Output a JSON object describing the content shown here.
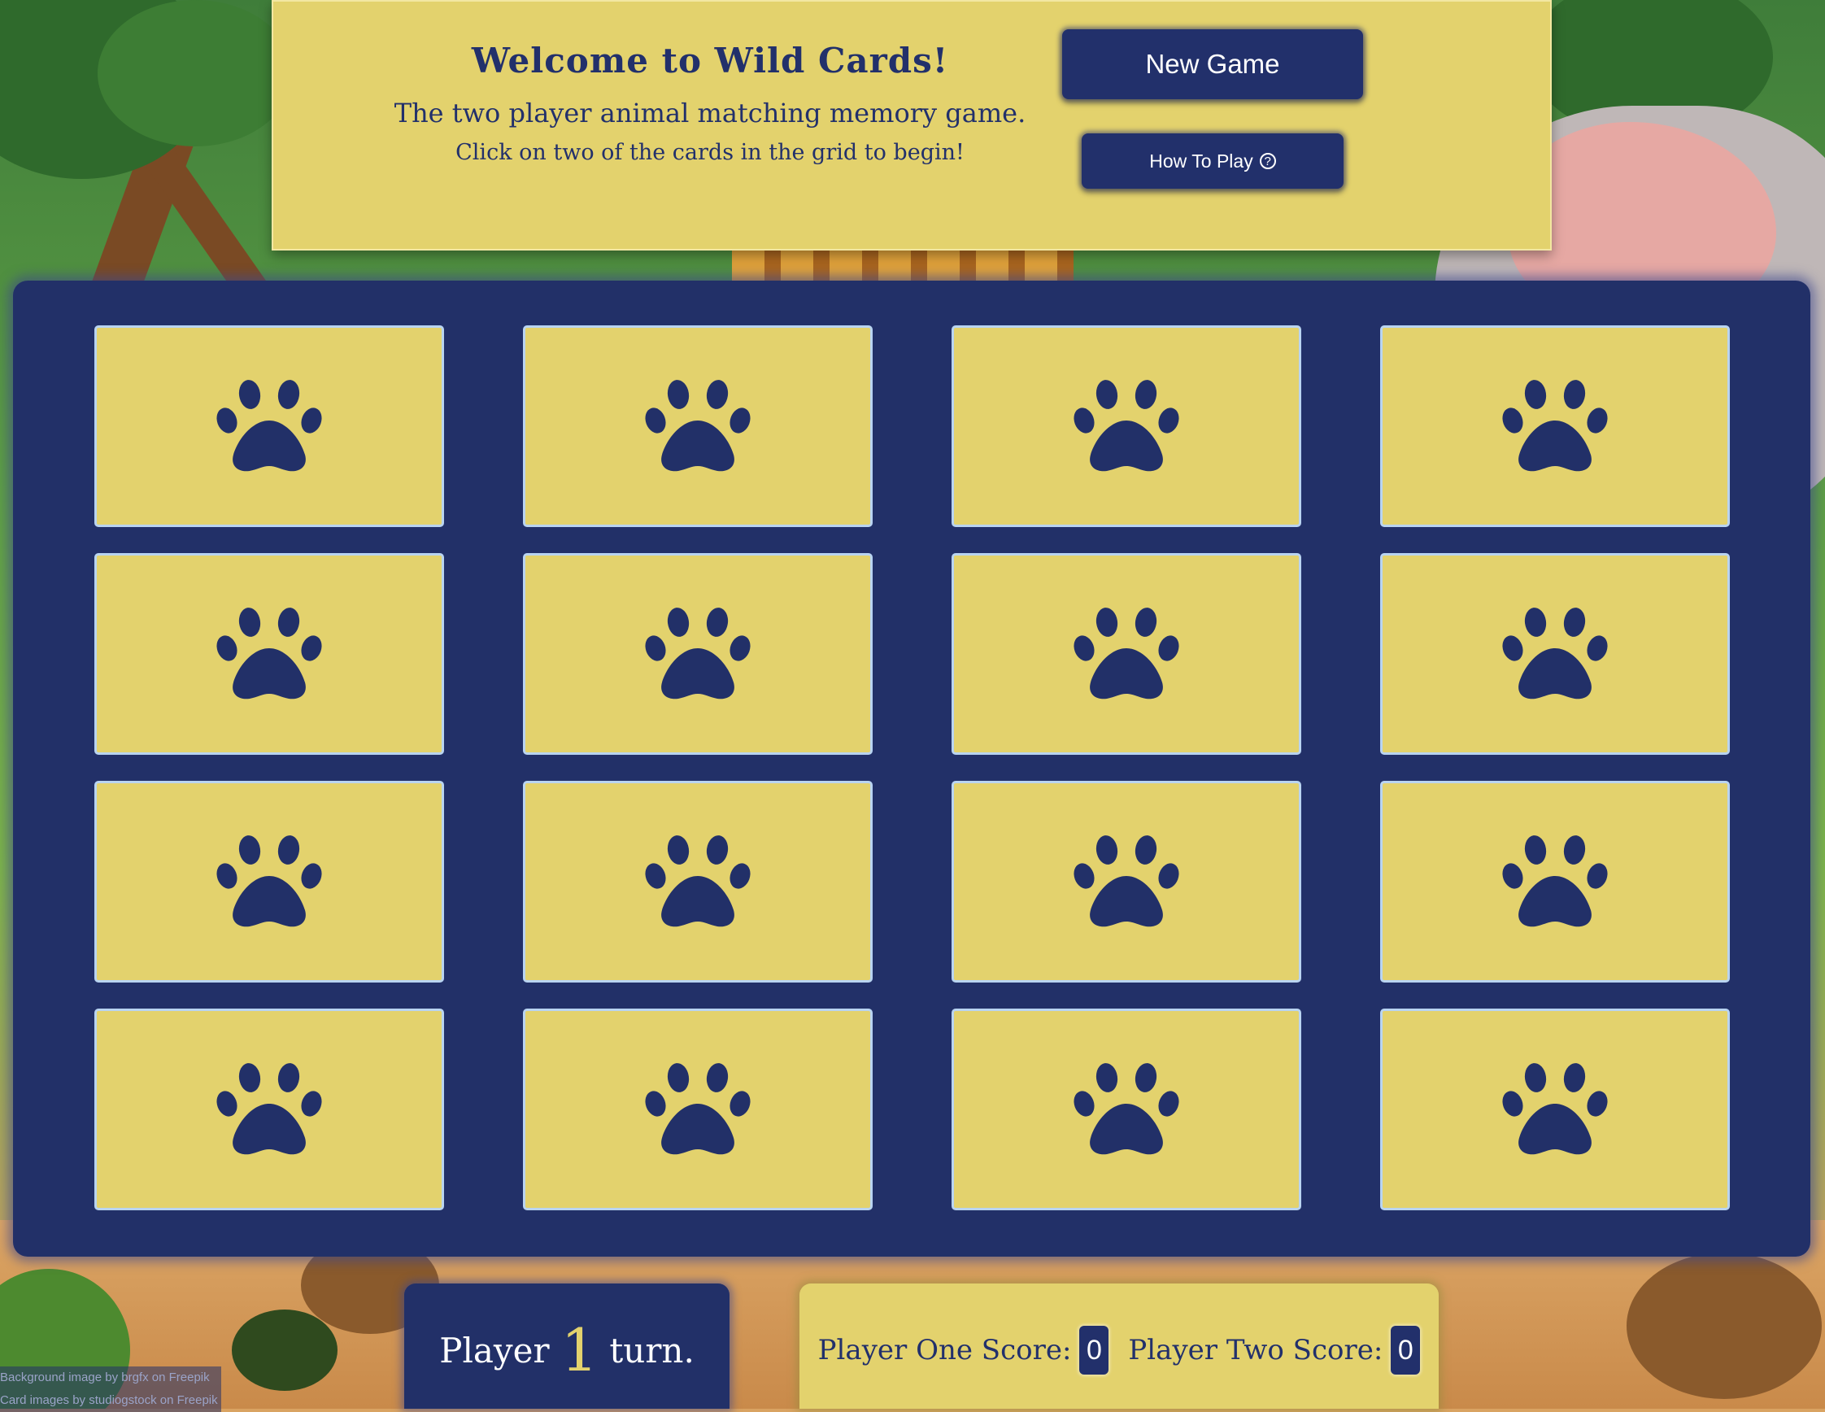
{
  "header": {
    "title": "Welcome to Wild Cards!",
    "subtitle": "The two player animal matching memory game.",
    "hint": "Click on two of the cards in the grid to begin!",
    "new_game_label": "New Game",
    "how_to_play_label": "How To Play",
    "help_icon_glyph": "?"
  },
  "board": {
    "rows": 4,
    "columns": 4,
    "card_face": "paw-print-icon",
    "colors": {
      "board": "#223068",
      "card": "#e3d26d",
      "paw": "#223068",
      "card_border": "#b9d4f1"
    }
  },
  "turn": {
    "prefix": "Player",
    "player": "1",
    "suffix": "turn."
  },
  "scores": {
    "player_one_label": "Player One Score:",
    "player_one_value": "0",
    "player_two_label": "Player Two Score:",
    "player_two_value": "0"
  },
  "credits": {
    "background": "Background image by brgfx on Freepik",
    "cards": "Card images by studiogstock on Freepik"
  }
}
